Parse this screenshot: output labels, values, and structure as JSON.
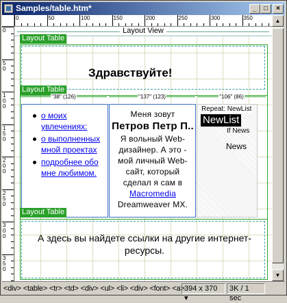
{
  "window": {
    "title": "Samples/table.htm*",
    "buttons": {
      "minimize": "_",
      "maximize": "□",
      "close": "×"
    }
  },
  "ruler": {
    "h_labels": [
      "0",
      "50",
      "100",
      "150",
      "200",
      "250",
      "300",
      "350"
    ],
    "v_labels": [
      "0",
      "50",
      "100",
      "150",
      "200",
      "250",
      "300",
      "350"
    ]
  },
  "layout_view": {
    "label": "Layout View",
    "outer_table_label": "Layout Table",
    "inner_table_label": "Layout Table",
    "bottom_table_label": "Layout Table",
    "column_widths": [
      "\"38\" (126)",
      "\"137\" (123)",
      "\"106\" (86)"
    ]
  },
  "content": {
    "greeting": "Здравствуйте!",
    "links": [
      "о моих увлечениях:",
      "о выполненных мной проектах",
      "подробнее обо мне любимом."
    ],
    "intro_pre": "Меня зовут",
    "name": "Петров Петр П..",
    "intro_rest": " Я вольный Web-дизайнер. А это - мой личный Web-сайт, который сделал я сам в ",
    "macromedia": "Macromedia",
    "intro_end": " Dreamweaver MX.",
    "repeat_label": "Repeat: NewList",
    "newlist": "NewList",
    "if_news": "If News",
    "news": "News",
    "bottom_text": "А здесь вы найдете ссылки на другие интернет-ресурсы."
  },
  "status": {
    "tags": "<div> <table> <tr> <td> <div> <ul> <li> <div> <font> <a>",
    "size": "394 x 370 ▾",
    "download": "3K / 1 sec"
  },
  "colors": {
    "layout_green": "#2aa02a",
    "cell_blue": "#3a70c0",
    "title_gradient_start": "#0a246a",
    "link": "#0000ee"
  }
}
